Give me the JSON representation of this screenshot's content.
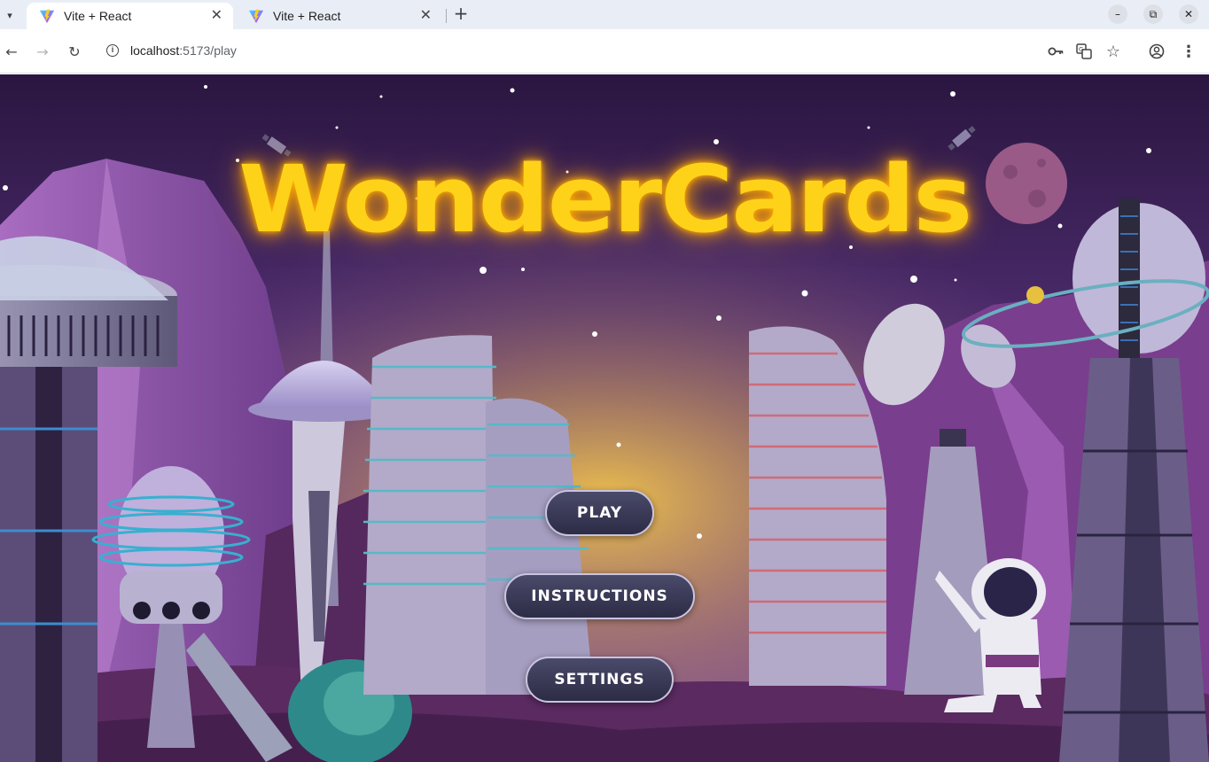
{
  "browser": {
    "tabs": [
      {
        "title": "Vite + React",
        "active": true
      },
      {
        "title": "Vite + React",
        "active": false
      }
    ],
    "url_host": "localhost",
    "url_path": ":5173/play"
  },
  "game": {
    "title": "WonderCards",
    "title_color": "#ffd21a",
    "buttons": {
      "play": "PLAY",
      "instructions": "INSTRUCTIONS",
      "settings": "SETTINGS"
    }
  }
}
